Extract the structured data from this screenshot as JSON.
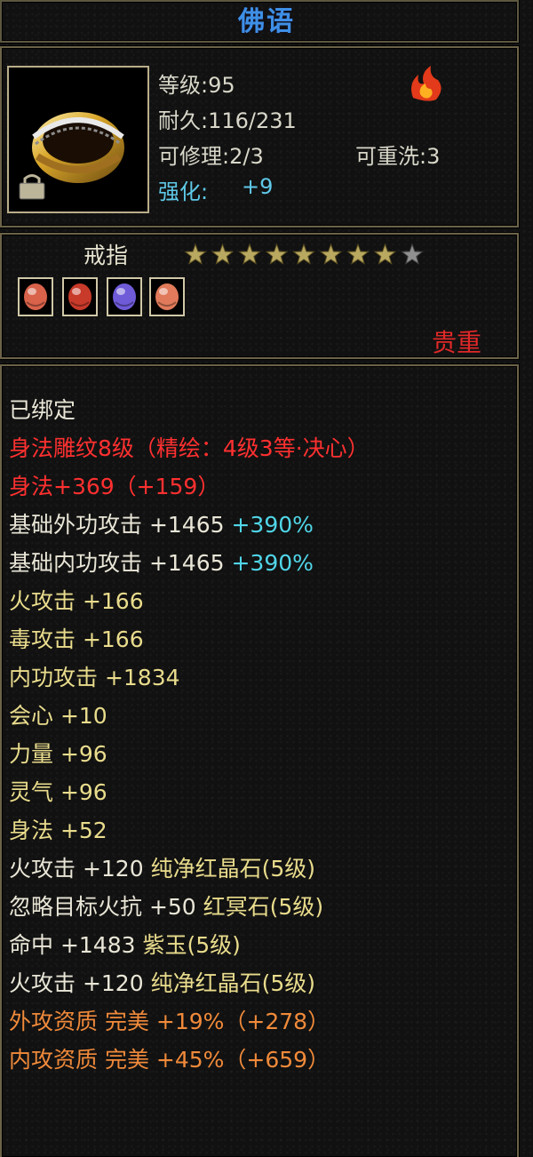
{
  "title": "佛语",
  "attributes": {
    "level": "等级:95",
    "durability": "耐久:116/231",
    "repairable": "可修理:2/3",
    "rewashable": "可重洗:3",
    "enhance_label": "强化:",
    "enhance_value": "+9"
  },
  "item": {
    "name": "戒指",
    "star_rating": {
      "filled": 8,
      "total": 9
    },
    "rarity": "贵重",
    "gems": [
      {
        "icon": "red-gem-icon",
        "color": "#d8624a"
      },
      {
        "icon": "red-gem-icon",
        "color": "#c83a2a"
      },
      {
        "icon": "purple-gem-icon",
        "color": "#6f5ad8"
      },
      {
        "icon": "red-gem-icon",
        "color": "#e07a5a"
      }
    ]
  },
  "colors": {
    "title": "#3e8fe6",
    "red": "#ff3030",
    "yellow": "#e9dc8c",
    "orange": "#f08a3a",
    "cyan": "#50d6e8"
  },
  "stats": {
    "bound": "已绑定",
    "carving": "身法雕纹8级（精绘：4级3等·决心）",
    "agility_bonus": "身法+369（+159）",
    "outer_attack": {
      "label": "基础外功攻击 +1465 ",
      "pct": "+390%"
    },
    "inner_attack": {
      "label": "基础内功攻击 +1465 ",
      "pct": "+390%"
    },
    "fire_attack": "火攻击 +166",
    "poison_attack": "毒攻击 +166",
    "inner_power": "内功攻击 +1834",
    "critical": "会心 +10",
    "strength": "力量 +96",
    "spirit": "灵气 +96",
    "agility": "身法 +52",
    "gem1": {
      "stat": "火攻击 +120 ",
      "gem": "纯净红晶石(5级)"
    },
    "gem2": {
      "stat": "忽略目标火抗 +50 ",
      "gem": "红冥石(5级)"
    },
    "gem3": {
      "stat": "命中 +1483 ",
      "gem": "紫玉(5级)"
    },
    "gem4": {
      "stat": "火攻击 +120 ",
      "gem": "纯净红晶石(5级)"
    },
    "outer_quality": "外攻资质  完美 +19%（+278）",
    "inner_quality": "内攻资质  完美 +45%（+659）"
  }
}
